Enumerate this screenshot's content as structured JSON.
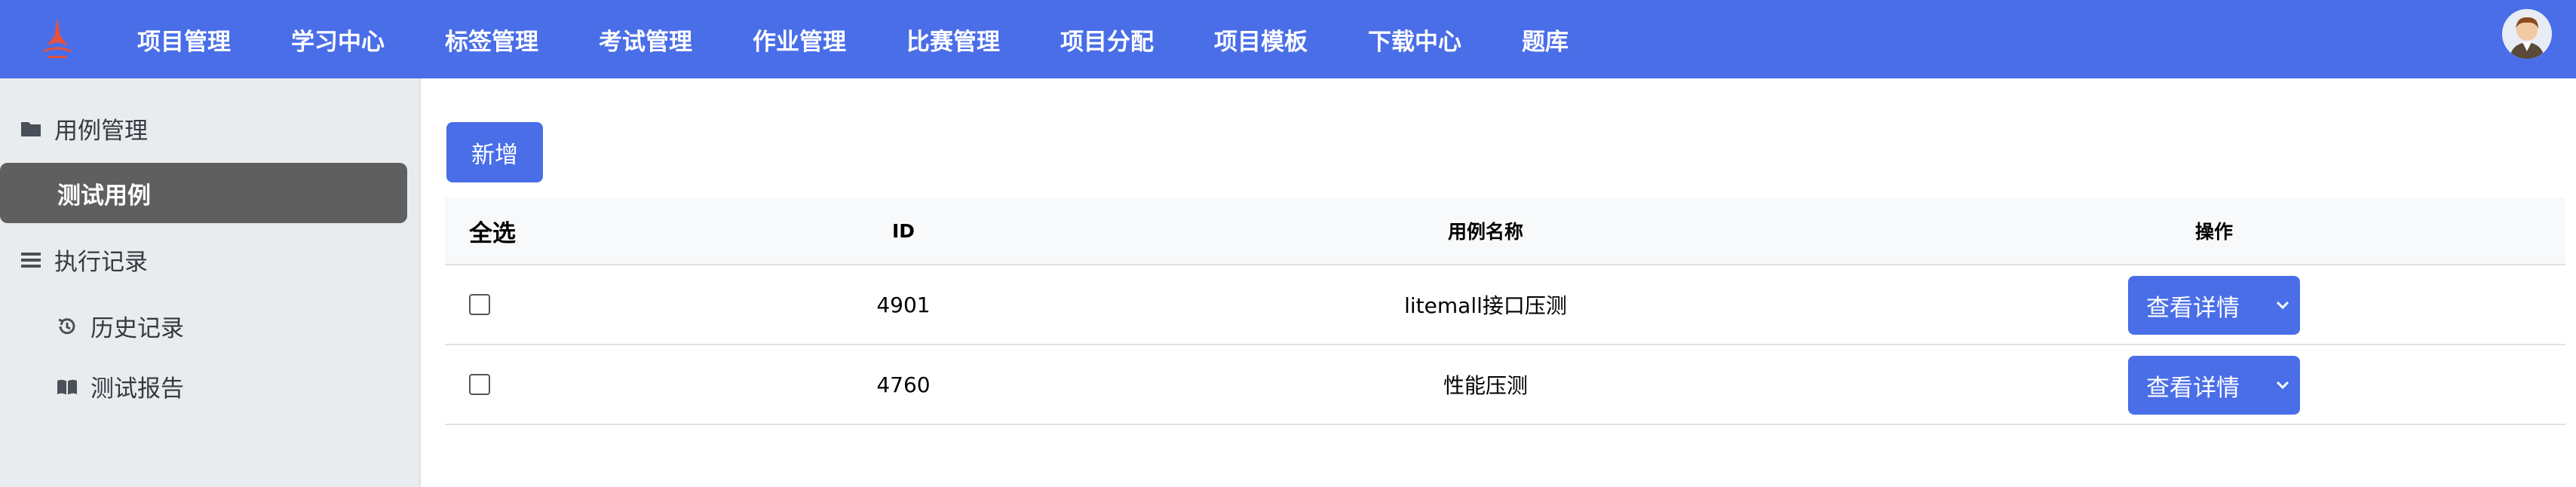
{
  "nav": {
    "items": [
      "项目管理",
      "学习中心",
      "标签管理",
      "考试管理",
      "作业管理",
      "比赛管理",
      "项目分配",
      "项目模板",
      "下载中心",
      "题库"
    ]
  },
  "sidebar": {
    "group1": {
      "label": "用例管理",
      "icon": "folder-icon"
    },
    "active_item": {
      "label": "测试用例"
    },
    "group2": {
      "label": "执行记录",
      "icon": "list-icon"
    },
    "sub_items": [
      {
        "label": "历史记录",
        "icon": "history-icon"
      },
      {
        "label": "测试报告",
        "icon": "book-icon"
      }
    ]
  },
  "main": {
    "add_button": "新增",
    "table": {
      "headers": {
        "select_all": "全选",
        "id": "ID",
        "name": "用例名称",
        "actions": "操作"
      },
      "rows": [
        {
          "id": "4901",
          "name": "litemall接口压测",
          "action": "查看详情"
        },
        {
          "id": "4760",
          "name": "性能压测",
          "action": "查看详情"
        }
      ]
    }
  },
  "colors": {
    "primary": "#4a6ee8",
    "sidebar_bg": "#e9ecef",
    "active_bg": "#5f5f5f"
  }
}
